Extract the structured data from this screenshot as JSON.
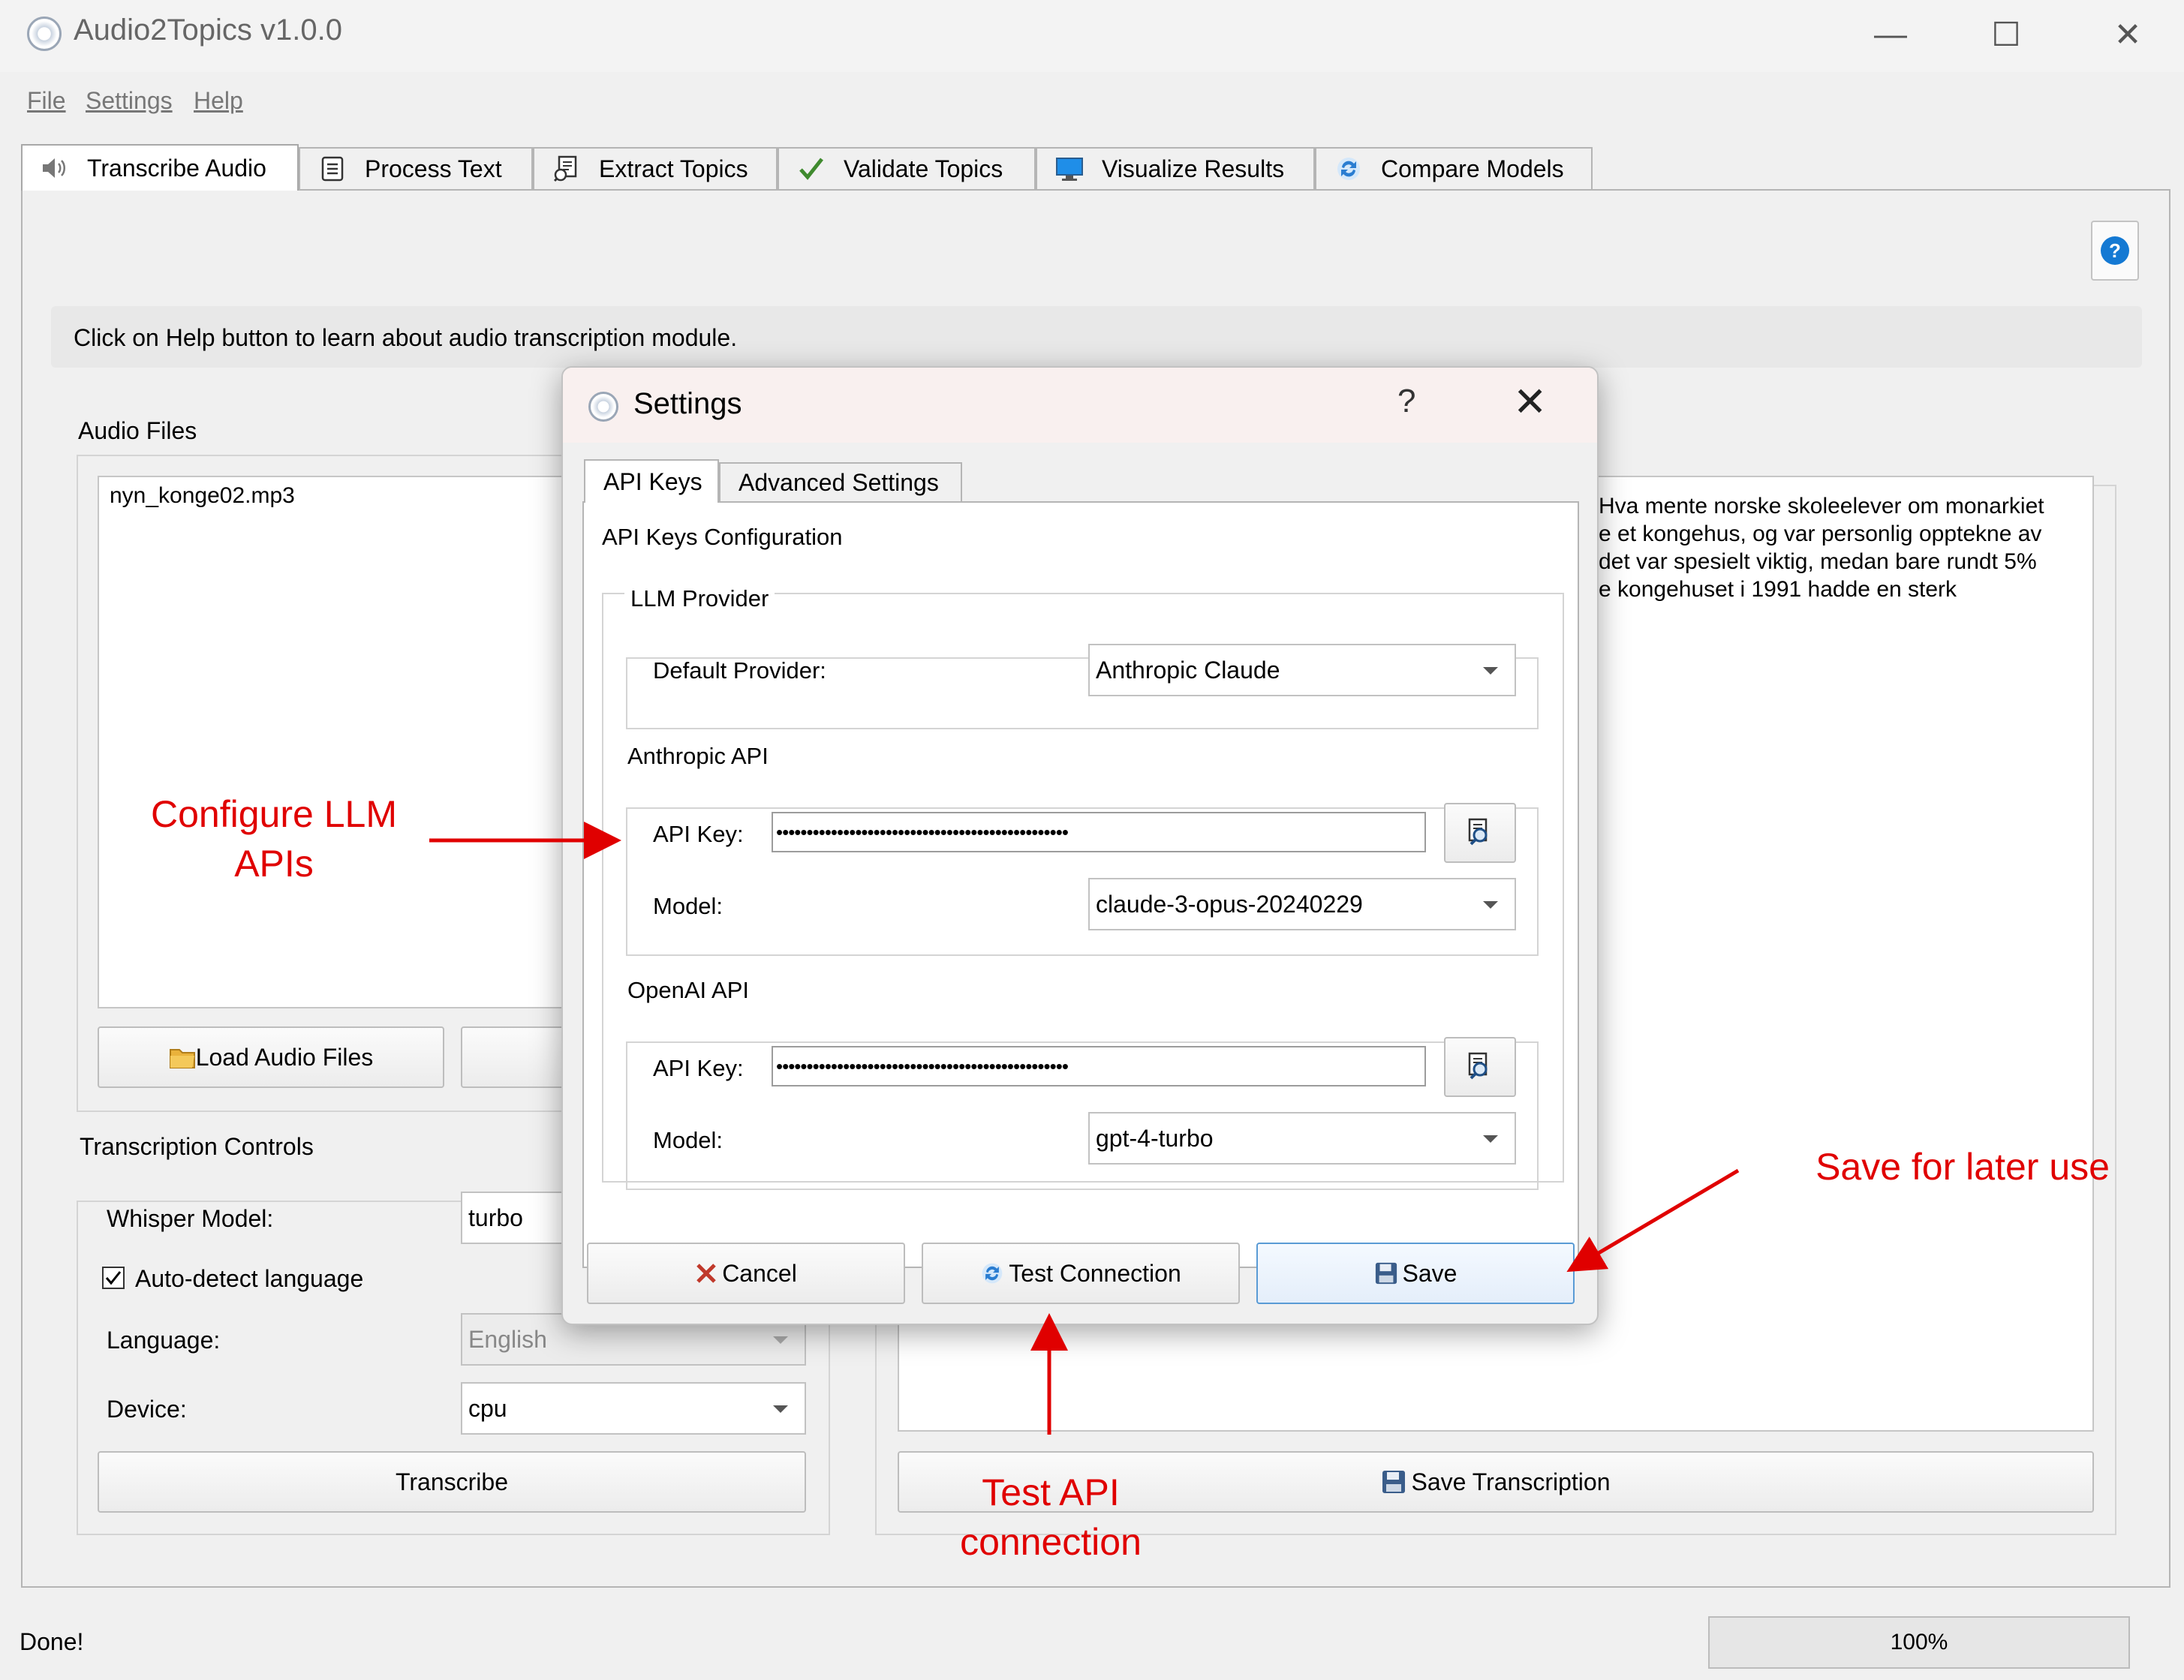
{
  "window": {
    "title": "Audio2Topics v1.0.0",
    "min": "—",
    "max": "☐",
    "close": "✕"
  },
  "menu": [
    "File",
    "Settings",
    "Help"
  ],
  "tabs": [
    {
      "label": "Transcribe Audio",
      "icon": "speaker-icon"
    },
    {
      "label": "Process Text",
      "icon": "document-icon"
    },
    {
      "label": "Extract Topics",
      "icon": "extract-icon"
    },
    {
      "label": "Validate Topics",
      "icon": "checkmark-icon"
    },
    {
      "label": "Visualize Results",
      "icon": "monitor-icon"
    },
    {
      "label": "Compare Models",
      "icon": "refresh-icon"
    }
  ],
  "info": "Click on Help button to learn about audio transcription module.",
  "audio": {
    "section_label": "Audio Files",
    "files": [
      "nyn_konge02.mp3"
    ],
    "load_button": "Load Audio Files"
  },
  "controls": {
    "section_label": "Transcription Controls",
    "whisper_label": "Whisper Model:",
    "whisper_value": "turbo",
    "autodetect_label": "Auto-detect language",
    "autodetect_checked": true,
    "language_label": "Language:",
    "language_value": "English",
    "device_label": "Device:",
    "device_value": "cpu",
    "transcribe_button": "Transcribe"
  },
  "transcript_preview": "Hva mente norske skoleelever om monarkiet\ne et kongehus, og var personlig opptekne av\ndet var spesielt viktig, medan bare rundt 5%\ne kongehuset i 1991 hadde en sterk",
  "save_transcription": "Save Transcription",
  "status": {
    "text": "Done!",
    "progress": "100%"
  },
  "dialog": {
    "title": "Settings",
    "help": "?",
    "close": "✕",
    "tabs": [
      "API Keys",
      "Advanced Settings"
    ],
    "heading": "API Keys Configuration",
    "llm_group": "LLM Provider",
    "default_provider_label": "Default Provider:",
    "default_provider_value": "Anthropic Claude",
    "anthropic_group": "Anthropic API",
    "anthropic_key_label": "API Key:",
    "anthropic_key_mask": "••••••••••••••••••••••••••••••••••••••••••••••••",
    "anthropic_model_label": "Model:",
    "anthropic_model_value": "claude-3-opus-20240229",
    "openai_group": "OpenAI API",
    "openai_key_label": "API Key:",
    "openai_key_mask": "••••••••••••••••••••••••••••••••••••••••••••••••",
    "openai_model_label": "Model:",
    "openai_model_value": "gpt-4-turbo",
    "cancel": "Cancel",
    "test": "Test Connection",
    "save": "Save"
  },
  "annotations": {
    "configure_line1": "Configure LLM",
    "configure_line2": "APIs",
    "save_later": "Save for later use",
    "test_line1": "Test API",
    "test_line2": "connection"
  },
  "colors": {
    "annotation": "#e00000",
    "help_blue": "#1479d3",
    "save_border": "#5a9bd5"
  }
}
